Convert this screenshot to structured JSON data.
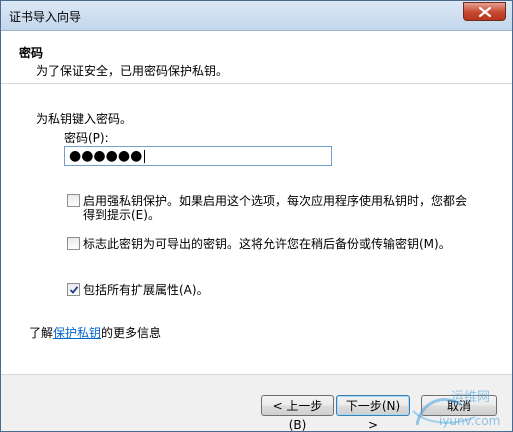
{
  "window": {
    "title": "证书导入向导"
  },
  "header": {
    "title": "密码",
    "subtitle": "为了保证安全，已用密码保护私钥。"
  },
  "main": {
    "prompt": "为私钥键入密码。",
    "password_label": "密码(P):",
    "password_value": "●●●●●●",
    "options": [
      {
        "line1": "启用强私钥保护。如果启用这个选项，每次应用程序使用私钥时，您都会",
        "line2": "得到提示(E)。",
        "checked": false
      },
      {
        "line1": "标志此密钥为可导出的密钥。这将允许您在稍后备份或传输密钥(M)。",
        "checked": false
      },
      {
        "line1": "包括所有扩展属性(A)。",
        "checked": true
      }
    ],
    "learn_more": {
      "prefix": "了解",
      "link": "保护私钥",
      "suffix": "的更多信息"
    }
  },
  "footer": {
    "back_label": "< 上一步(B)",
    "next_label": "下一步(N) >",
    "cancel_label": "取消"
  },
  "watermark": {
    "text": "运维网",
    "url": "iyunv.com"
  }
}
